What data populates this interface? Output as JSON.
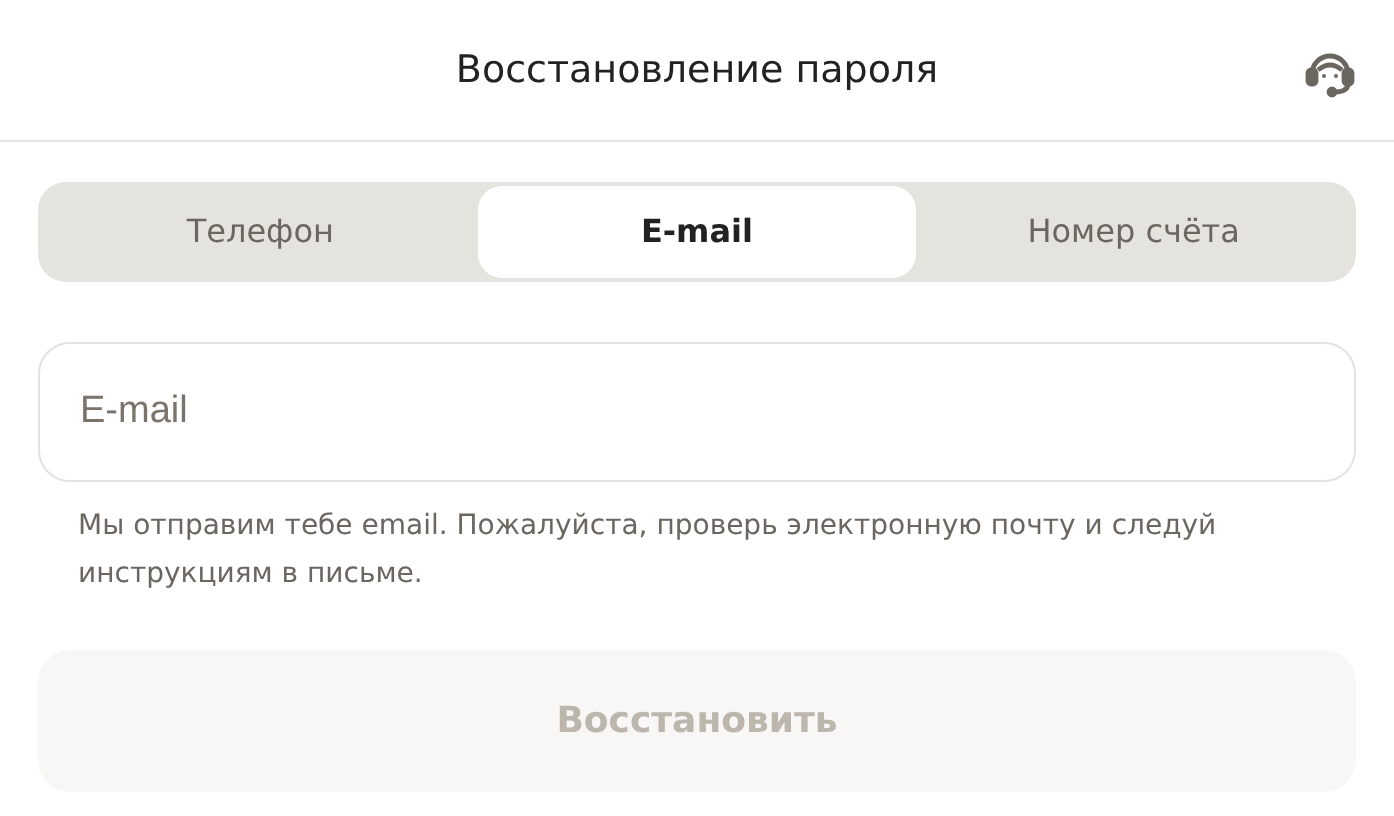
{
  "window": {
    "title": "Восстановление пароля"
  },
  "tabs": [
    {
      "label": "Телефон",
      "selected": false
    },
    {
      "label": "E-mail",
      "selected": true
    },
    {
      "label": "Номер счёта",
      "selected": false
    }
  ],
  "email_field": {
    "placeholder": "E-mail"
  },
  "hint": "Мы отправим тебе email. Пожалуйста, проверь электронную почту и следуй инструкциям в письме.",
  "submit_button": {
    "label": "Восстановить",
    "disabled": true
  }
}
